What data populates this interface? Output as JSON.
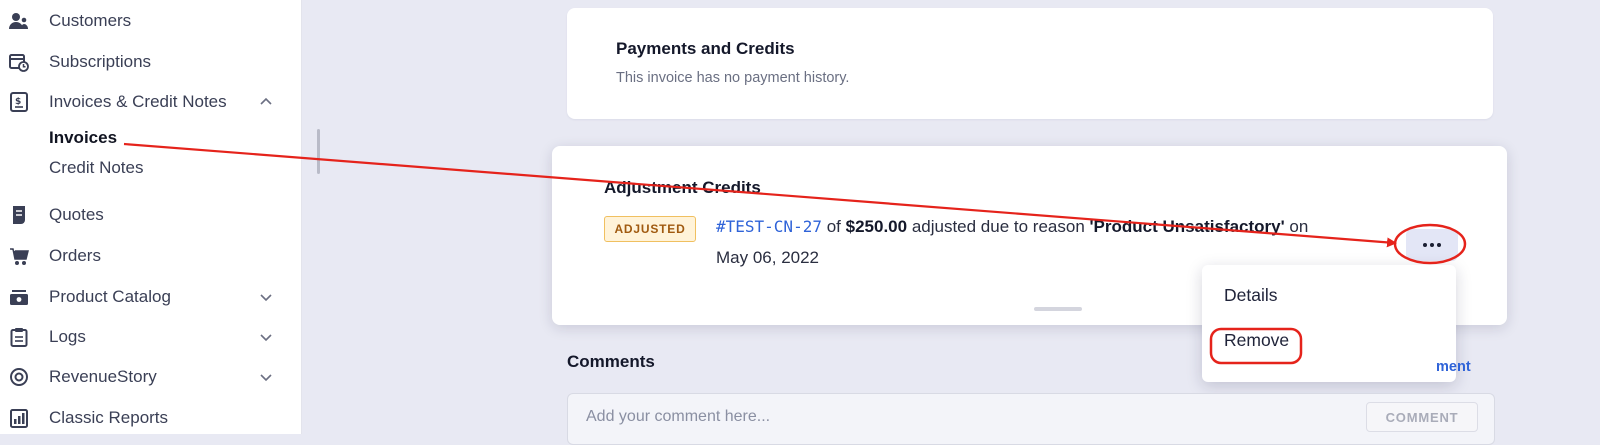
{
  "sidebar": {
    "items": [
      {
        "label": "Customers",
        "icon": "customers-icon"
      },
      {
        "label": "Subscriptions",
        "icon": "calendar-clock-icon"
      },
      {
        "label": "Invoices & Credit Notes",
        "icon": "invoice-icon"
      },
      {
        "label": "Quotes",
        "icon": "quote-icon"
      },
      {
        "label": "Orders",
        "icon": "cart-icon"
      },
      {
        "label": "Product Catalog",
        "icon": "catalog-icon"
      },
      {
        "label": "Logs",
        "icon": "clipboard-icon"
      },
      {
        "label": "RevenueStory",
        "icon": "target-icon"
      },
      {
        "label": "Classic Reports",
        "icon": "report-icon"
      }
    ],
    "sub_items": [
      {
        "label": "Invoices",
        "active": true
      },
      {
        "label": "Credit Notes",
        "active": false
      }
    ]
  },
  "payments": {
    "title": "Payments and Credits",
    "empty_text": "This invoice has no payment history."
  },
  "adjustment": {
    "title": "Adjustment Credits",
    "badge": "ADJUSTED",
    "credit_note_id": "#TEST-CN-27",
    "of_text": "of",
    "amount": "$250.00",
    "reason_prefix": "adjusted due to reason",
    "reason": "'Product Unsatisfactory'",
    "on_text": "on",
    "date": "May 06, 2022"
  },
  "menu": {
    "items": [
      "Details",
      "Remove"
    ]
  },
  "comments": {
    "title": "Comments",
    "link_label": "ment",
    "placeholder": "Add your comment here...",
    "button_label": "COMMENT"
  },
  "colors": {
    "accent": "#2f63d8",
    "annotation": "#e5231b",
    "badge_bg": "#fff3d9",
    "badge_text": "#a05a10"
  }
}
